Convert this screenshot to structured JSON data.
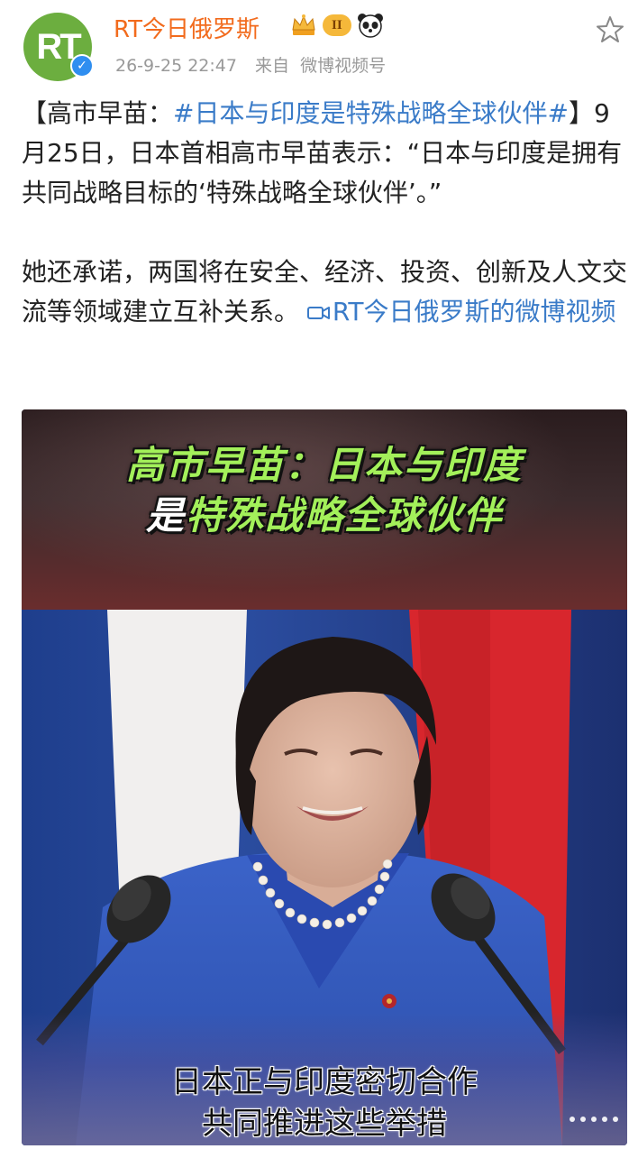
{
  "author": {
    "name": "RT今日俄罗斯",
    "avatar_text": "RT",
    "level_badge": "II"
  },
  "meta": {
    "timestamp": "26-9-25 22:47",
    "source_prefix": "来自",
    "source": "微博视频号"
  },
  "post": {
    "bracket_open": "【高市早苗：",
    "topic": "#日本与印度是特殊战略全球伙伴#",
    "para1_rest": "】9月25日，日本首相高市早苗表示：“日本与印度是拥有共同战略目标的‘特殊战略全球伙伴’。”",
    "para2": "她还承诺，两国将在安全、经济、投资、创新及人文交流等领域建立互补关系。",
    "video_link_label": "RT今日俄罗斯的微博视频"
  },
  "video": {
    "headline_line1": "高市早苗：日本与印度",
    "headline_line2_white": "是",
    "headline_line2_rest": "特殊战略全球伙伴",
    "subtitle_line1": "日本正与印度密切合作",
    "subtitle_line2": "共同推进这些举措"
  },
  "colors": {
    "author": "#f26b1d",
    "link": "#3a7bc8",
    "headline": "#a3f05a"
  }
}
